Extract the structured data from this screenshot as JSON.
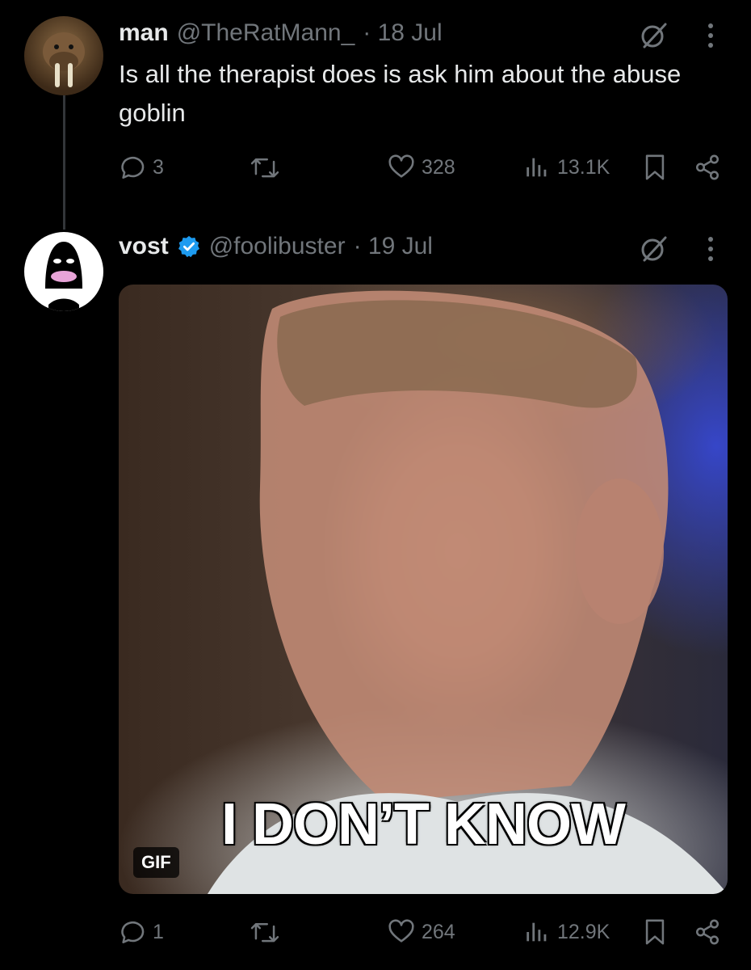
{
  "tweets": [
    {
      "name": "man",
      "handle": "@TheRatMann_",
      "date": "· 18 Jul",
      "text": "Is all the therapist does is ask him about the abuse goblin",
      "replies": "3",
      "retweets": "",
      "likes": "328",
      "views": "13.1K"
    },
    {
      "name": "vost",
      "handle": "@foolibuster",
      "date": "· 19 Jul",
      "media": {
        "badge": "GIF",
        "caption": "I DON’T KNOW"
      },
      "replies": "1",
      "retweets": "",
      "likes": "264",
      "views": "12.9K"
    }
  ],
  "colors": {
    "background": "#000000",
    "text": "#e7e9ea",
    "muted": "#71767b",
    "verified": "#1d9bf0"
  }
}
